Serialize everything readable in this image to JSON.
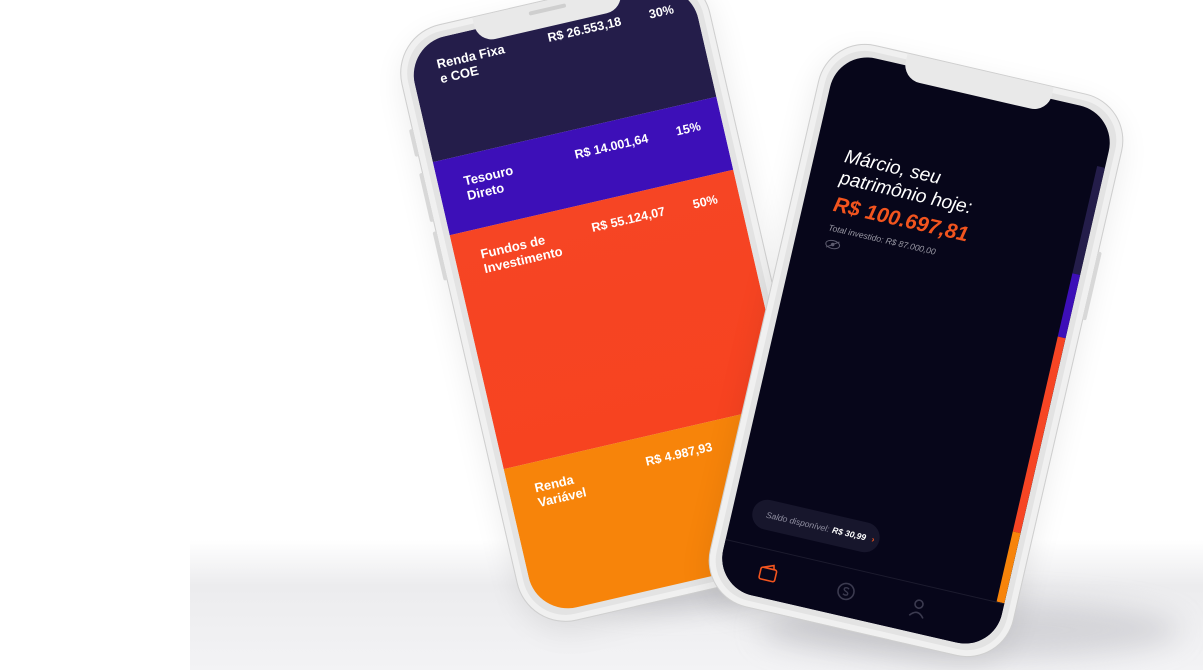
{
  "left_phone": {
    "segments": [
      {
        "label": "Renda Fixa\ne COE",
        "amount": "R$ 26.553,18",
        "percent": "30%",
        "color": "#241d4a"
      },
      {
        "label": "Tesouro\nDireto",
        "amount": "R$ 14.001,64",
        "percent": "15%",
        "color": "#3d0fb8"
      },
      {
        "label": "Fundos de\nInvestimento",
        "amount": "R$ 55.124,07",
        "percent": "50%",
        "color": "#f64524"
      },
      {
        "label": "Renda\nVariável",
        "amount": "R$ 4.987,93",
        "percent": "",
        "color": "#f7840a"
      }
    ]
  },
  "right_phone": {
    "greeting": "Márcio, seu\npatrimônio hoje:",
    "balance": "R$ 100.697,81",
    "total_invested": "Total investido:  R$ 87.000,00",
    "saldo_label": "Saldo disponível:",
    "saldo_value": "R$ 30,99",
    "chevron": "›",
    "icons": {
      "eye": "eye-hidden-icon",
      "tab1": "wallet-icon",
      "tab2": "coin-icon",
      "tab3": "profile-icon"
    },
    "accent_color": "#f2541e"
  }
}
